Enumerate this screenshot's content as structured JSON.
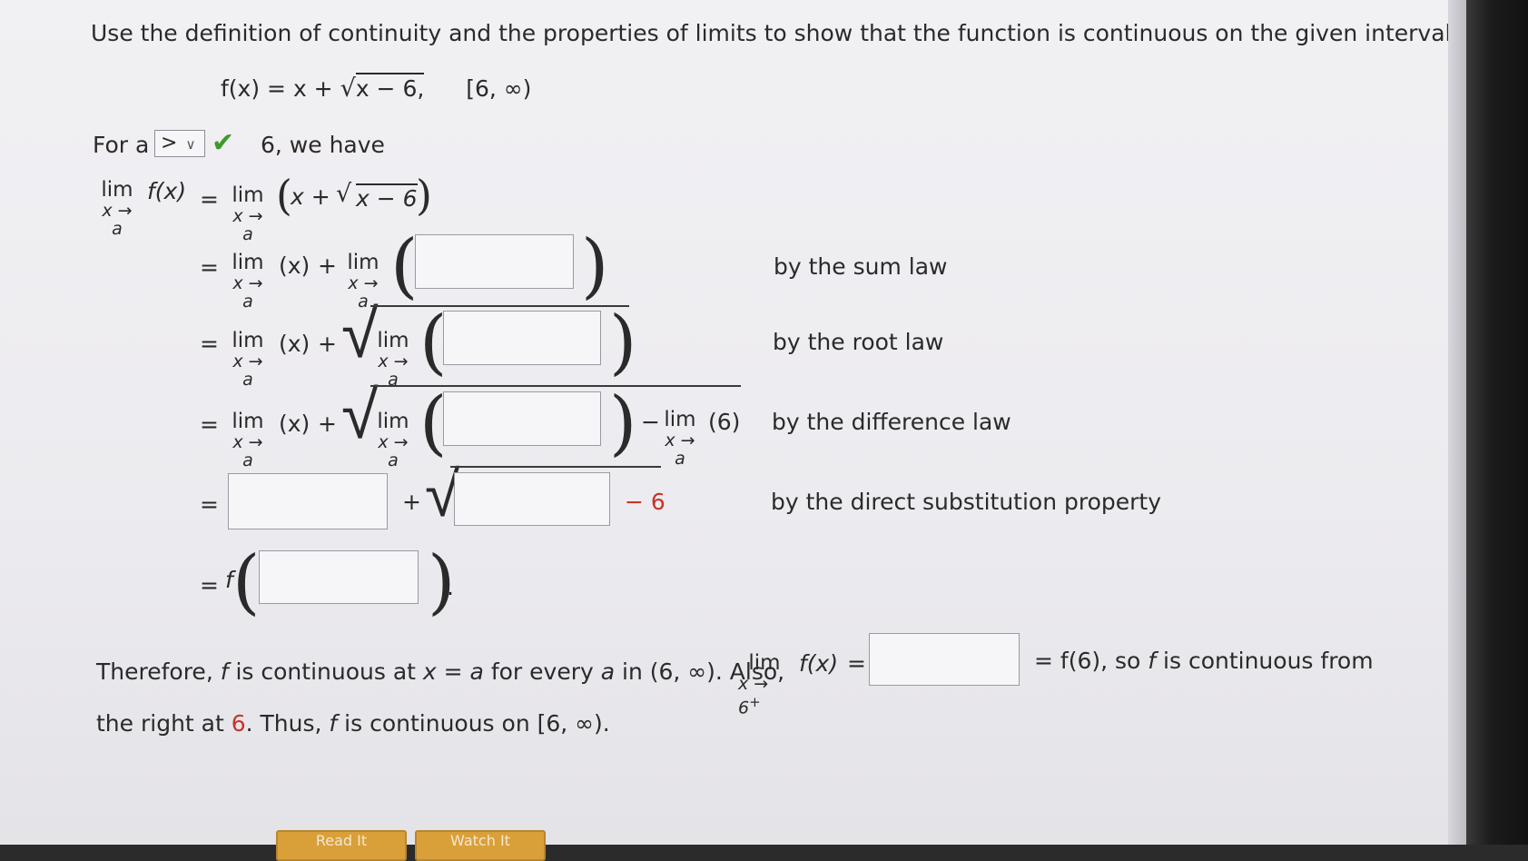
{
  "problem": {
    "instruction": "Use the definition of continuity and the properties of limits to show that the function is continuous on the given interval.",
    "function_lhs": "f(x) = x + ",
    "function_radicand": "x − 6,",
    "interval": "[6, ∞)"
  },
  "step_intro": {
    "prefix": "For a",
    "select_value": ">",
    "select_caret": "∨",
    "suffix": "6, we have"
  },
  "limit_text": {
    "lim": "lim",
    "sub_a": "x → a",
    "sub_6plus": "x → 6",
    "plus_sign": "+",
    "fx": "f(x)",
    "eq": "=",
    "x_paren": "(x)",
    "plus": "+",
    "minus": "−",
    "six_paren": "(6)",
    "row1_expr_x": "x + ",
    "row1_expr_rad": "x − 6",
    "minus_6": "− 6",
    "f": "f",
    "period": "."
  },
  "justifications": {
    "sum": "by the sum law",
    "root": "by the root law",
    "difference": "by the difference law",
    "direct": "by the direct substitution property"
  },
  "conclusion": {
    "part1": "Therefore, ",
    "f1": "f",
    "part2": " is continuous at ",
    "x": "x",
    "part3": " = ",
    "a1": "a",
    "part4": " for every ",
    "a2": "a",
    "part5": " in (6, ∞). Also,",
    "fx": "f(x)",
    "eq": "=",
    "after_box": "= f(6), so ",
    "f2": "f",
    "after_box2": " is continuous from",
    "line2_a": "the right at ",
    "line2_six": "6",
    "line2_b": ". Thus, ",
    "f3": "f",
    "line2_c": " is continuous on [6, ∞)."
  },
  "buttons": {
    "read_it": "Read It",
    "watch_it": "Watch It"
  }
}
